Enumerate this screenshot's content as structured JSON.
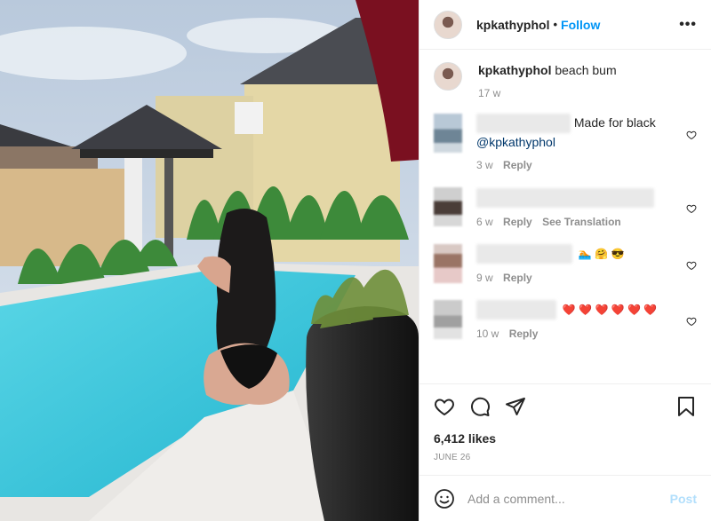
{
  "post": {
    "username": "kpkathyphol",
    "follow_label": "Follow",
    "more_label": "•••",
    "caption_text": "beach bum",
    "caption_time": "17 w",
    "likes": "6,412 likes",
    "date": "JUNE 26"
  },
  "comments": [
    {
      "text": "Made for black",
      "mention": "@kpkathyphol",
      "time": "3 w",
      "reply": "Reply",
      "translate": ""
    },
    {
      "text": "",
      "mention": "",
      "time": "6 w",
      "reply": "Reply",
      "translate": "See Translation"
    },
    {
      "text": "🏊 🤗 😎",
      "mention": "",
      "time": "9 w",
      "reply": "Reply",
      "translate": ""
    },
    {
      "text": "❤️ ❤️ ❤️ ❤️ ❤️ ❤️",
      "mention": "",
      "time": "10 w",
      "reply": "Reply",
      "translate": ""
    }
  ],
  "add_comment": {
    "placeholder": "Add a comment...",
    "post_label": "Post"
  },
  "icons": {
    "like": "heart-icon",
    "comment": "comment-icon",
    "share": "share-icon",
    "save": "bookmark-icon",
    "emoji": "smile-icon"
  },
  "colors": {
    "accent": "#0095f6",
    "post_disabled": "#b2dffc",
    "heart": "#e0245e"
  }
}
